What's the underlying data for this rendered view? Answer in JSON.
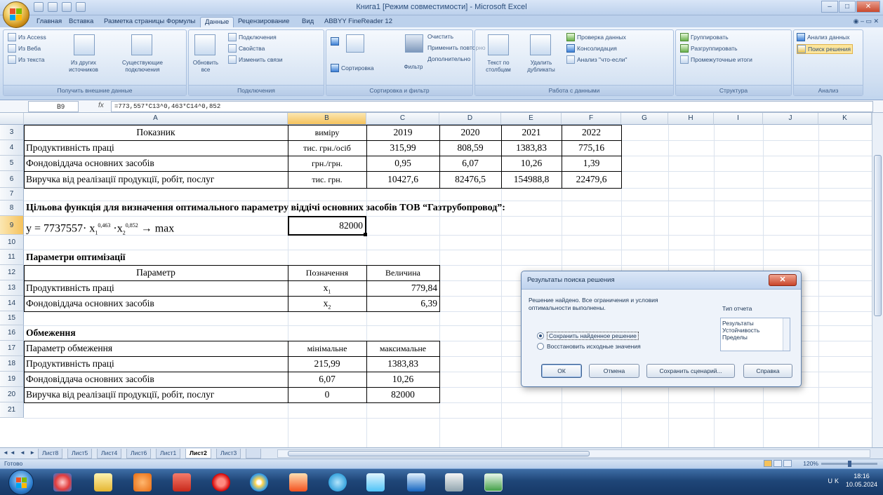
{
  "window": {
    "title": "Книга1  [Режим совместимости] - Microsoft Excel",
    "controls": [
      "–",
      "□",
      "✕"
    ]
  },
  "ribbon_tabs": [
    "Главная",
    "Вставка",
    "Разметка страницы",
    "Формулы",
    "Данные",
    "Рецензирование",
    "Вид",
    "ABBYY FineReader 12"
  ],
  "ribbon_tab_right": "◉  –  ▭  ✕",
  "ribbon": {
    "external": {
      "items": [
        "Из Access",
        "Из Веба",
        "Из текста",
        "Из других источников",
        "Существующие подключения"
      ],
      "label": "Получить внешние данные"
    },
    "connections": {
      "refresh": "Обновить все",
      "items": [
        "Подключения",
        "Свойства",
        "Изменить связи"
      ],
      "label": "Подключения"
    },
    "sort": {
      "sort": "Сортировка",
      "filter": "Фильтр",
      "items": [
        "Очистить",
        "Применить повторно",
        "Дополнительно"
      ],
      "label": "Сортировка и фильтр"
    },
    "tools": {
      "text_to_cols": "Текст по столбцам",
      "remove_dup": "Удалить дубликаты",
      "items": [
        "Проверка данных",
        "Консолидация",
        "Анализ \"что-если\""
      ],
      "label": "Работа с данными"
    },
    "outline": {
      "items": [
        "Группировать",
        "Разгруппировать",
        "Промежуточные итоги"
      ],
      "label": "Структура"
    },
    "analysis": {
      "items": [
        "Анализ данных",
        "Поиск решения"
      ],
      "label": "Анализ"
    }
  },
  "formula_bar": {
    "cell_ref": "B9",
    "fx": "fx",
    "formula": "=773,557*C13^0,463*C14^0,852"
  },
  "columns": [
    "A",
    "B",
    "C",
    "D",
    "E",
    "F",
    "G",
    "H",
    "I",
    "J",
    "K"
  ],
  "rows": [
    "3",
    "4",
    "5",
    "6",
    "7",
    "8",
    "9",
    "10",
    "11",
    "12",
    "13",
    "14",
    "15",
    "16",
    "17",
    "18",
    "19",
    "20",
    "21"
  ],
  "sheet": {
    "r3": {
      "a": "Показник",
      "b": "виміру",
      "c": "2019",
      "d": "2020",
      "e": "2021",
      "f": "2022"
    },
    "r4": {
      "a": "Продуктивність праці",
      "b": "тис. грн./осіб",
      "c": "315,99",
      "d": "808,59",
      "e": "1383,83",
      "f": "775,16"
    },
    "r5": {
      "a": "Фондовіддача  основних засобів",
      "b": "грн./грн.",
      "c": "0,95",
      "d": "6,07",
      "e": "10,26",
      "f": "1,39"
    },
    "r6": {
      "a": "Виручка від реалізації продукції, робіт, послуг",
      "b": "тис. грн.",
      "c": "10427,6",
      "d": "82476,5",
      "e": "154988,8",
      "f": "22479,6"
    },
    "r8": {
      "a": "Цільова функція для визначення оптимального параметру віддічі основних засобів ТОВ “Газтрубопровод”:"
    },
    "r9": {
      "a_prefix": "y = 7737557· x",
      "a_sub1": "1",
      "a_sup1": "0,463",
      "a_mid": " ·x",
      "a_sub2": "2",
      "a_sup2": "0,852",
      "a_suffix": " → max",
      "b": "82000"
    },
    "r11": {
      "a": "Параметри оптимізації"
    },
    "r12": {
      "a": "Параметр",
      "b": "Позначення",
      "c": "Величина"
    },
    "r13": {
      "a": "Продуктивність праці",
      "b_base": "x",
      "b_sub": "1",
      "c": "779,84"
    },
    "r14": {
      "a": "Фондовіддача  основних засобів",
      "b_base": "x",
      "b_sub": "2",
      "c": "6,39"
    },
    "r16": {
      "a": "Обмеження"
    },
    "r17": {
      "a": "Параметр обмеження",
      "b": "мінімальне",
      "c": "максимальне"
    },
    "r18": {
      "a": "Продуктивність праці",
      "b": "215,99",
      "c": "1383,83"
    },
    "r19": {
      "a": "Фондовіддача  основних засобів",
      "b": "6,07",
      "c": "10,26"
    },
    "r20": {
      "a": "Виручка від реалізації продукції, робіт, послуг",
      "b": "0",
      "c": "82000"
    }
  },
  "sheet_tabs": [
    "Лист8",
    "Лист5",
    "Лист4",
    "Лист6",
    "Лист1",
    "Лист2",
    "Лист3"
  ],
  "active_sheet": "Лист2",
  "sheet_nav": "◄◄ ◄ ► ►►",
  "status": {
    "ready": "Готово",
    "zoom": "120%"
  },
  "dialog": {
    "title": "Результаты поиска решения",
    "close": "✕",
    "message": "Решение найдено. Все ограничения и условия оптимальности выполнены.",
    "report_label": "Тип отчета",
    "reports": [
      "Результаты",
      "Устойчивость",
      "Пределы"
    ],
    "radio_keep": "Сохранить найденное решение",
    "radio_restore": "Восстановить исходные значения",
    "btn_ok": "ОК",
    "btn_cancel": "Отмена",
    "btn_save": "Сохранить сценарий...",
    "btn_help": "Справка"
  },
  "taskbar": {
    "lang": "UK",
    "time": "18:16",
    "date": "10.05.2024"
  }
}
